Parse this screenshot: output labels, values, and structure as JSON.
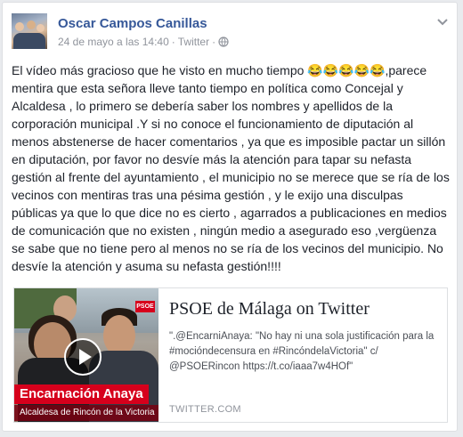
{
  "post": {
    "author": "Oscar Campos Canillas",
    "timestamp": "24 de mayo a las 14:40",
    "source": "Twitter",
    "separator": "·",
    "body": "El vídeo más gracioso que he visto en mucho tiempo 😂😂😂😂😂,parece mentira que esta señora lleve tanto tiempo en política como Concejal y Alcaldesa , lo primero se debería saber los nombres y apellidos de la corporación municipal .Y si no conoce el funcionamiento de diputación al menos abstenerse de hacer comentarios , ya que es imposible pactar un sillón en diputación, por favor no desvíe más la atención para tapar su nefasta gestión al frente del ayuntamiento , el municipio no se merece que se ría de los vecinos con mentiras tras una pésima gestión , y le exijo una disculpas públicas ya que lo que dice no es cierto , agarrados a publicaciones en medios de comunicación que no existen , ningún medio a asegurado eso ,vergüenza se sabe que no tiene pero al menos no se ría de los vecinos del municipio. No desvíe la atención y asuma su nefasta gestión!!!!"
  },
  "card": {
    "title": "PSOE de Málaga on Twitter",
    "description": "\".@EncarniAnaya: \"No hay ni una sola justificación para la #mocióndecensura en #RincóndelaVictoria\" c/ @PSOERincon https://t.co/iaaa7w4HOf\"",
    "domain": "TWITTER.COM",
    "thumbnail": {
      "lower_third_name": "Encarnación Anaya",
      "lower_third_role": "Alcaldesa de Rincón de la Victoria",
      "logo_text": "PSOE"
    }
  },
  "colors": {
    "author_link": "#365899",
    "meta_gray": "#90949c",
    "psoe_red": "#d6001c"
  },
  "icons": [
    "globe-icon",
    "chevron-down-icon",
    "play-icon"
  ]
}
